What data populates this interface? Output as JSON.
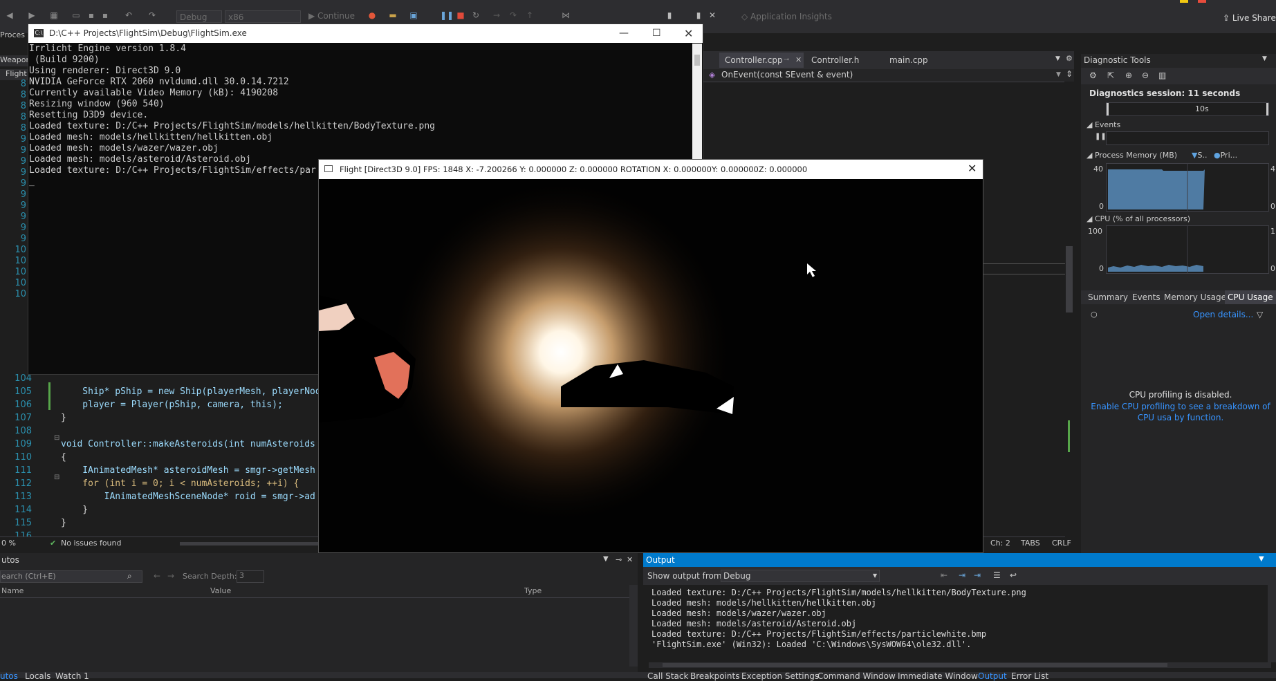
{
  "vs": {
    "config": "Debug",
    "platform": "x86",
    "continue_label": "Continue",
    "app_insights": "Application Insights",
    "live_share": "Live Share",
    "left_stub_process": "Proces",
    "left_stub_weapons": "Weapons",
    "left_stub_flight": "Flight"
  },
  "tabs": [
    "Controller.cpp",
    "Controller.h",
    "main.cpp"
  ],
  "nav_member": "OnEvent(const SEvent & event)",
  "console": {
    "title": "D:\\C++ Projects\\FlightSim\\Debug\\FlightSim.exe",
    "lines": [
      "Irrlicht Engine version 1.8.4",
      " (Build 9200)",
      "Using renderer: Direct3D 9.0",
      "NVIDIA GeForce RTX 2060 nvldumd.dll 30.0.14.7212",
      "Currently available Video Memory (kB): 4190208",
      "Resizing window (960 540)",
      "Resetting D3D9 device.",
      "Loaded texture: D:/C++ Projects/FlightSim/models/hellkitten/BodyTexture.png",
      "Loaded mesh: models/hellkitten/hellkitten.obj",
      "Loaded mesh: models/wazer/wazer.obj",
      "Loaded mesh: models/asteroid/Asteroid.obj",
      "Loaded texture: D:/C++ Projects/FlightSim/effects/par"
    ],
    "cursor": "_"
  },
  "game": {
    "title": "Flight [Direct3D 9.0] FPS: 1848 X: -7.200266 Y: 0.000000 Z: 0.000000 ROTATION X: 0.000000Y: 0.000000Z: 0.000000"
  },
  "gutter_stub": [
    "8",
    "8",
    "8",
    "8",
    "8",
    "9",
    "9",
    "9",
    "9",
    "9",
    "9",
    "9",
    "9",
    "9",
    "9",
    "10",
    "10",
    "10",
    "10",
    "10"
  ],
  "code": [
    {
      "ln": "105",
      "text": "    Ship* pShip = new Ship(playerMesh, playerNod"
    },
    {
      "ln": "106",
      "text": "    player = Player(pShip, camera, this);"
    },
    {
      "ln": "107",
      "text": "}"
    },
    {
      "ln": "108",
      "text": ""
    },
    {
      "ln": "109",
      "text": "void Controller::makeAsteroids(int numAsteroids"
    },
    {
      "ln": "110",
      "text": "{"
    },
    {
      "ln": "111",
      "text": "    IAnimatedMesh* asteroidMesh = smgr->getMesh"
    },
    {
      "ln": "112",
      "text": "    for (int i = 0; i < numAsteroids; ++i) {"
    },
    {
      "ln": "113",
      "text": "        IAnimatedMeshSceneNode* roid = smgr->ad"
    },
    {
      "ln": "114",
      "text": "    }"
    },
    {
      "ln": "115",
      "text": "}"
    },
    {
      "ln": "116",
      "text": ""
    }
  ],
  "ln_104": "104",
  "editor_status": {
    "zoom": "0 %",
    "issues": "No issues found",
    "ch": "Ch: 2",
    "tabs": "TABS",
    "eol": "CRLF"
  },
  "diag": {
    "title": "Diagnostic Tools",
    "session": "Diagnostics session: 11 seconds",
    "timeline_label": "10s",
    "events_label": "Events",
    "memory_label": "Process Memory (MB)",
    "memory_legend": [
      "S..",
      "Pri..."
    ],
    "memory_ymax": "40",
    "memory_ymin": "0",
    "memory_ymax_r": "4",
    "memory_ymin_r": "0",
    "cpu_label": "CPU (% of all processors)",
    "cpu_ymax": "100",
    "cpu_ymin": "0",
    "cpu_ymax_r": "1",
    "cpu_ymin_r": "0",
    "tabs": [
      "Summary",
      "Events",
      "Memory Usage",
      "CPU Usage"
    ],
    "open_details": "Open details...",
    "disabled_msg": "CPU profiling is disabled.",
    "enable_msg": "Enable CPU profiling to see a breakdown of CPU usa by function."
  },
  "autos": {
    "title": "utos",
    "search_placeholder": "earch (Ctrl+E)",
    "search_depth_label": "Search Depth:",
    "search_depth_value": "3",
    "columns": [
      "Name",
      "Value",
      "Type"
    ],
    "tabs": [
      "utos",
      "Locals",
      "Watch 1"
    ]
  },
  "output": {
    "title": "Output",
    "show_from_label": "Show output from:",
    "show_from_value": "Debug",
    "lines": [
      "Loaded texture: D:/C++ Projects/FlightSim/models/hellkitten/BodyTexture.png",
      "Loaded mesh: models/hellkitten/hellkitten.obj",
      "Loaded mesh: models/wazer/wazer.obj",
      "Loaded mesh: models/asteroid/Asteroid.obj",
      "Loaded texture: D:/C++ Projects/FlightSim/effects/particlewhite.bmp",
      "'FlightSim.exe' (Win32): Loaded 'C:\\Windows\\SysWOW64\\ole32.dll'."
    ],
    "tabs": [
      "Call Stack",
      "Breakpoints",
      "Exception Settings",
      "Command Window",
      "Immediate Window",
      "Output",
      "Error List"
    ]
  },
  "colors": {
    "accent": "#007acc",
    "link": "#3794ff",
    "chart_fill": "#4f7ba3",
    "panel": "#252526"
  }
}
